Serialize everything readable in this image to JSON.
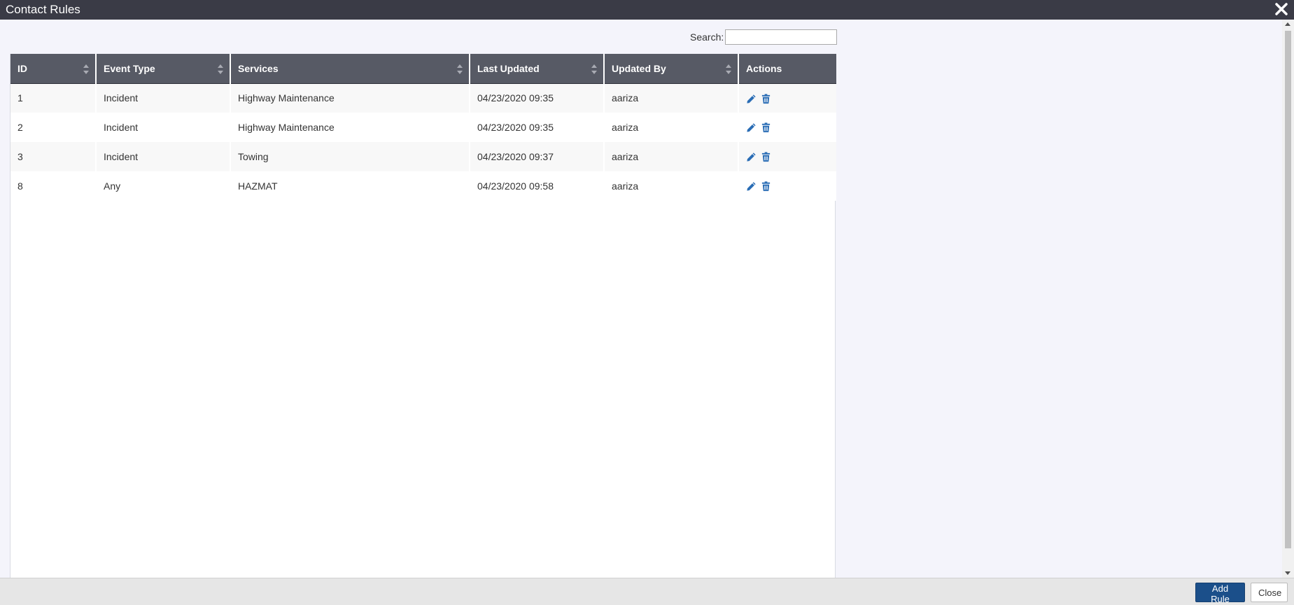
{
  "window": {
    "title": "Contact Rules",
    "close_icon": "close-x-icon"
  },
  "search": {
    "label": "Search:",
    "value": "",
    "placeholder": ""
  },
  "table": {
    "columns": [
      "ID",
      "Event Type",
      "Services",
      "Last Updated",
      "Updated By",
      "Actions"
    ],
    "rows": [
      {
        "id": "1",
        "event_type": "Incident",
        "services": "Highway Maintenance",
        "last_updated": "04/23/2020 09:35",
        "updated_by": "aariza"
      },
      {
        "id": "2",
        "event_type": "Incident",
        "services": "Highway Maintenance",
        "last_updated": "04/23/2020 09:35",
        "updated_by": "aariza"
      },
      {
        "id": "3",
        "event_type": "Incident",
        "services": "Towing",
        "last_updated": "04/23/2020 09:37",
        "updated_by": "aariza"
      },
      {
        "id": "8",
        "event_type": "Any",
        "services": "HAZMAT",
        "last_updated": "04/23/2020 09:58",
        "updated_by": "aariza"
      }
    ],
    "action_icons": [
      "pencil-icon",
      "trash-icon"
    ],
    "action_color": "#2a6db5"
  },
  "footer": {
    "add_rule_label": "Add Rule",
    "close_label": "Close"
  },
  "colors": {
    "titlebar": "#3a3b46",
    "header": "#575a65",
    "primary_button": "#1b4f8a"
  }
}
